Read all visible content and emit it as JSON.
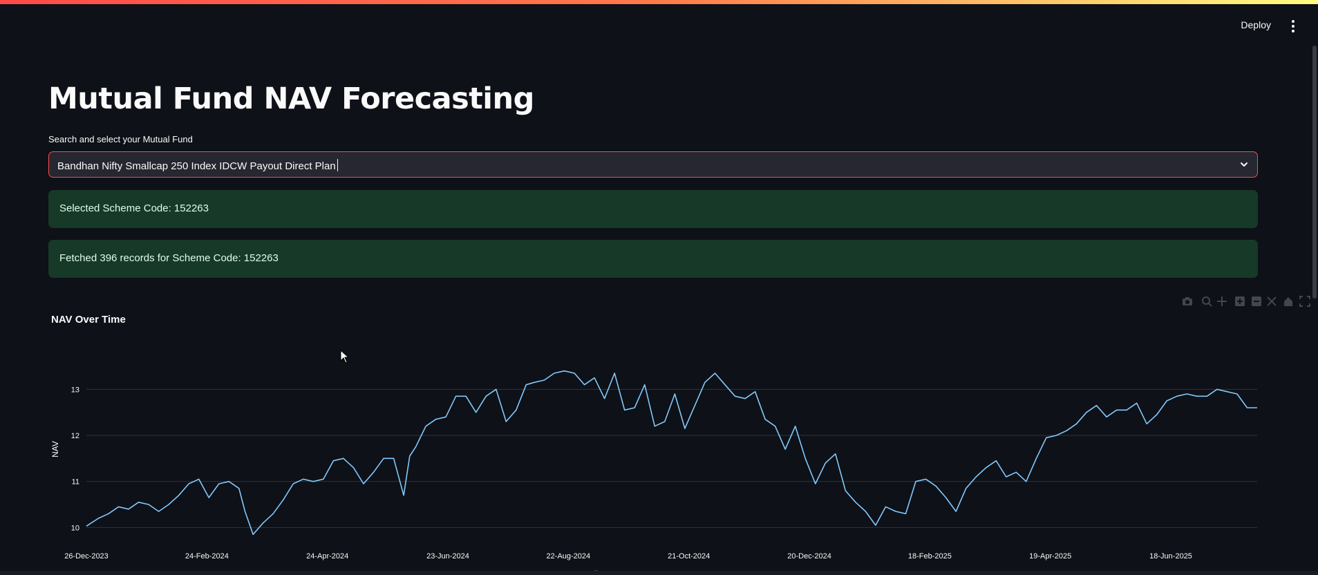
{
  "header": {
    "deploy_label": "Deploy",
    "menu_icon": "kebab-menu-icon"
  },
  "page": {
    "title": "Mutual Fund NAV Forecasting"
  },
  "fund_select": {
    "label": "Search and select your Mutual Fund",
    "value": "Bandhan Nifty Smallcap 250 Index IDCW Payout Direct Plan",
    "icon": "chevron-down-icon"
  },
  "alerts": [
    {
      "text": "Selected Scheme Code: 152263"
    },
    {
      "text": "Fetched 396 records for Scheme Code: 152263"
    }
  ],
  "modebar_icons": [
    "camera-icon",
    "zoom-icon",
    "pan-icon",
    "zoom-in-icon",
    "zoom-out-icon",
    "autoscale-icon",
    "reset-axes-icon",
    "fullscreen-icon"
  ],
  "chart_data": {
    "type": "line",
    "title": "NAV Over Time",
    "xlabel": "Date",
    "ylabel": "NAV",
    "line_color": "#83c9ff",
    "grid": true,
    "xlim": [
      "2023-12-26",
      "2025-07-31"
    ],
    "ylim": [
      9.75,
      13.65
    ],
    "x_ticks": [
      "26-Dec-2023",
      "24-Feb-2024",
      "24-Apr-2024",
      "23-Jun-2024",
      "22-Aug-2024",
      "21-Oct-2024",
      "20-Dec-2024",
      "18-Feb-2025",
      "19-Apr-2025",
      "18-Jun-2025"
    ],
    "y_ticks": [
      10,
      11,
      12,
      13
    ],
    "series": [
      {
        "x": [
          "2023-12-26",
          "2024-01-01",
          "2024-01-06",
          "2024-01-11",
          "2024-01-16",
          "2024-01-21",
          "2024-01-26",
          "2024-01-31",
          "2024-02-05",
          "2024-02-10",
          "2024-02-15",
          "2024-02-20",
          "2024-02-25",
          "2024-03-01",
          "2024-03-06",
          "2024-03-11",
          "2024-03-14",
          "2024-03-18",
          "2024-03-23",
          "2024-03-28",
          "2024-04-02",
          "2024-04-07",
          "2024-04-12",
          "2024-04-17",
          "2024-04-22",
          "2024-04-27",
          "2024-05-02",
          "2024-05-07",
          "2024-05-12",
          "2024-05-17",
          "2024-05-22",
          "2024-05-27",
          "2024-06-01",
          "2024-06-04",
          "2024-06-07",
          "2024-06-12",
          "2024-06-17",
          "2024-06-22",
          "2024-06-27",
          "2024-07-02",
          "2024-07-07",
          "2024-07-12",
          "2024-07-17",
          "2024-07-22",
          "2024-07-27",
          "2024-08-01",
          "2024-08-05",
          "2024-08-10",
          "2024-08-15",
          "2024-08-20",
          "2024-08-25",
          "2024-08-30",
          "2024-09-04",
          "2024-09-09",
          "2024-09-14",
          "2024-09-19",
          "2024-09-24",
          "2024-09-29",
          "2024-10-04",
          "2024-10-09",
          "2024-10-14",
          "2024-10-19",
          "2024-10-24",
          "2024-10-29",
          "2024-11-03",
          "2024-11-08",
          "2024-11-13",
          "2024-11-18",
          "2024-11-23",
          "2024-11-28",
          "2024-12-03",
          "2024-12-08",
          "2024-12-13",
          "2024-12-18",
          "2024-12-23",
          "2024-12-28",
          "2025-01-02",
          "2025-01-07",
          "2025-01-12",
          "2025-01-17",
          "2025-01-22",
          "2025-01-27",
          "2025-02-01",
          "2025-02-06",
          "2025-02-11",
          "2025-02-16",
          "2025-02-21",
          "2025-02-26",
          "2025-03-03",
          "2025-03-08",
          "2025-03-13",
          "2025-03-18",
          "2025-03-23",
          "2025-03-28",
          "2025-04-02",
          "2025-04-07",
          "2025-04-12",
          "2025-04-17",
          "2025-04-22",
          "2025-04-27",
          "2025-05-02",
          "2025-05-07",
          "2025-05-12",
          "2025-05-17",
          "2025-05-22",
          "2025-05-27",
          "2025-06-01",
          "2025-06-06",
          "2025-06-11",
          "2025-06-16",
          "2025-06-21",
          "2025-06-26",
          "2025-07-01",
          "2025-07-06",
          "2025-07-11",
          "2025-07-16",
          "2025-07-21",
          "2025-07-26",
          "2025-07-31"
        ],
        "y": [
          10.03,
          10.2,
          10.3,
          10.45,
          10.4,
          10.55,
          10.5,
          10.35,
          10.5,
          10.7,
          10.95,
          11.05,
          10.65,
          10.95,
          11.0,
          10.85,
          10.35,
          9.85,
          10.1,
          10.3,
          10.6,
          10.95,
          11.05,
          11.0,
          11.05,
          11.45,
          11.5,
          11.3,
          10.95,
          11.2,
          11.5,
          11.5,
          10.7,
          11.55,
          11.75,
          12.2,
          12.35,
          12.4,
          12.85,
          12.85,
          12.5,
          12.85,
          13.0,
          12.3,
          12.55,
          13.1,
          13.15,
          13.2,
          13.35,
          13.4,
          13.35,
          13.1,
          13.25,
          12.8,
          13.35,
          12.55,
          12.6,
          13.1,
          12.2,
          12.3,
          12.9,
          12.15,
          12.65,
          13.15,
          13.35,
          13.1,
          12.85,
          12.8,
          12.95,
          12.35,
          12.2,
          11.7,
          12.2,
          11.5,
          10.95,
          11.4,
          11.6,
          10.8,
          10.55,
          10.35,
          10.05,
          10.45,
          10.35,
          10.3,
          11.0,
          11.05,
          10.9,
          10.65,
          10.35,
          10.85,
          11.1,
          11.3,
          11.45,
          11.1,
          11.2,
          11.0,
          11.5,
          11.95,
          12.0,
          12.1,
          12.25,
          12.5,
          12.65,
          12.4,
          12.55,
          12.55,
          12.7,
          12.25,
          12.45,
          12.75,
          12.85,
          12.9,
          12.85,
          12.85,
          13.0,
          12.95,
          12.9,
          12.6,
          12.6
        ]
      }
    ]
  }
}
